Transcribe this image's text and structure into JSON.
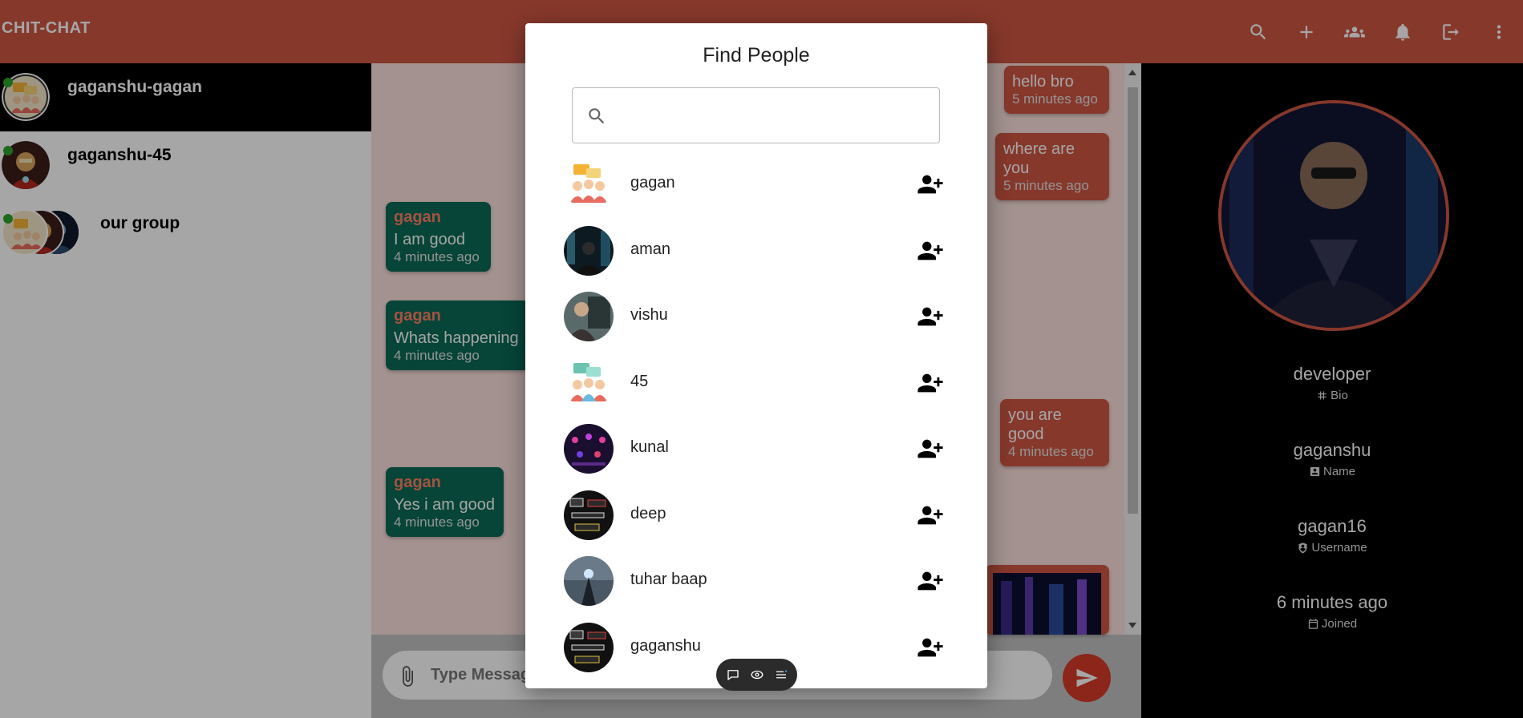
{
  "app": {
    "brand": "CHIT-CHAT"
  },
  "topbar": {
    "icons": [
      "search-icon",
      "plus-icon",
      "group-icon",
      "bell-icon",
      "logout-icon",
      "more-vert-icon"
    ]
  },
  "sidebar": {
    "chats": [
      {
        "name": "gaganshu-gagan",
        "active": true,
        "online": true
      },
      {
        "name": "gaganshu-45",
        "active": false,
        "online": true
      },
      {
        "name": "our group",
        "active": false,
        "online": true,
        "group": true
      }
    ]
  },
  "messages": [
    {
      "dir": "out",
      "text": "hello bro",
      "time": "5 minutes ago"
    },
    {
      "dir": "out",
      "text": "where are you",
      "time": "5 minutes ago"
    },
    {
      "dir": "in",
      "sender": "gagan",
      "text": "I am good",
      "time": "4 minutes ago"
    },
    {
      "dir": "in",
      "sender": "gagan",
      "text": "Whats happening",
      "time": "4 minutes ago"
    },
    {
      "dir": "out",
      "text": "you are good",
      "time": "4 minutes ago"
    },
    {
      "dir": "in",
      "sender": "gagan",
      "text": "Yes i am good",
      "time": "4 minutes ago"
    }
  ],
  "composer": {
    "placeholder": "Type Message"
  },
  "profile": {
    "bio": {
      "value": "developer",
      "label": "Bio"
    },
    "name": {
      "value": "gaganshu",
      "label": "Name"
    },
    "username": {
      "value": "gagan16",
      "label": "Username"
    },
    "joined": {
      "value": "6 minutes ago",
      "label": "Joined"
    }
  },
  "modal": {
    "title": "Find People",
    "search_value": "",
    "people": [
      {
        "name": "gagan"
      },
      {
        "name": "aman"
      },
      {
        "name": "vishu"
      },
      {
        "name": "45"
      },
      {
        "name": "kunal"
      },
      {
        "name": "deep"
      },
      {
        "name": "tuhar baap"
      },
      {
        "name": "gaganshu"
      }
    ]
  },
  "colors": {
    "topbar": "#ce5742",
    "incoming_bubble": "#0a6a57",
    "outgoing_bubble": "#ce5742",
    "sender_name": "#ff7f66",
    "online_dot": "#2ca52c"
  }
}
